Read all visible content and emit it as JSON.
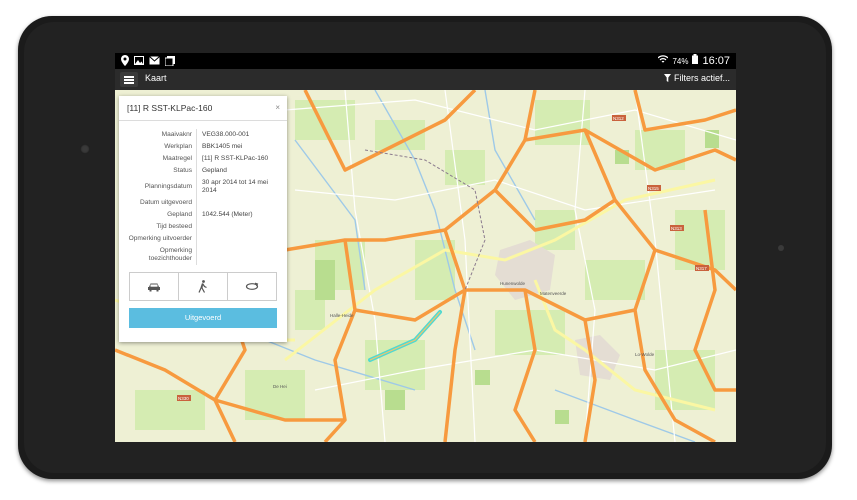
{
  "status_bar": {
    "battery": "74%",
    "time": "16:07"
  },
  "action_bar": {
    "title": "Kaart",
    "filter_label": "Filters actief..."
  },
  "panel": {
    "title": "[11] R SST-KLPac-160",
    "close": "×",
    "rows": [
      {
        "label": "Maaivaknr",
        "value": "VEG38.000-001"
      },
      {
        "label": "Werkplan",
        "value": "BBK1405 mei"
      },
      {
        "label": "Maatregel",
        "value": "[11] R SST-KLPac-160"
      },
      {
        "label": "Status",
        "value": "Gepland"
      },
      {
        "label": "Planningsdatum",
        "value": "30 apr 2014 tot 14 mei 2014"
      },
      {
        "label": "Datum uitgevoerd",
        "value": ""
      },
      {
        "label": "Gepland",
        "value": "1042.544 (Meter)"
      },
      {
        "label": "Tijd besteed",
        "value": ""
      },
      {
        "label": "Opmerking uitvoerder",
        "value": ""
      },
      {
        "label": "Opmerking toezichthouder",
        "value": ""
      }
    ],
    "done_label": "Uitgevoerd"
  },
  "map": {
    "place_labels": [
      "Hunenwolde",
      "Matenveerde",
      "Halle-Heide",
      "De Hei",
      "Lo-Wolde"
    ],
    "road_labels": [
      "N312",
      "N315",
      "N313",
      "N330",
      "N317"
    ]
  },
  "colors": {
    "map_bg": "#eef0d4",
    "road_orange": "#f79a3f",
    "road_yellow": "#fbf7a3",
    "water": "#9ec9e8",
    "farmland": "#d5ecb2",
    "highlight": "#4fd9d2",
    "button_blue": "#5bbde0"
  }
}
